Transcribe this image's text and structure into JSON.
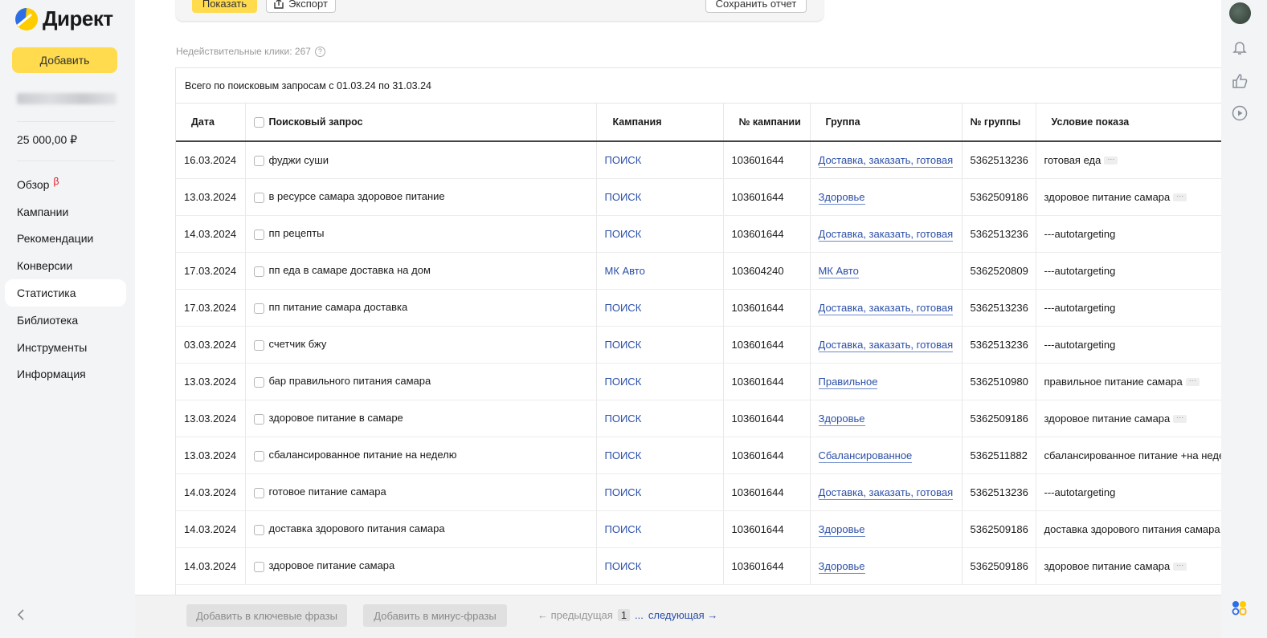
{
  "app": {
    "logo_text": "Директ",
    "brand_colors": {
      "yellow": "#ffdb4d",
      "link": "#2b4fa8",
      "beta": "#e0101e"
    }
  },
  "sidebar": {
    "add_label": "Добавить",
    "balance": "25 000,00 ₽",
    "items": [
      {
        "label": "Обзор",
        "badge": "β",
        "active": false
      },
      {
        "label": "Кампании",
        "active": false
      },
      {
        "label": "Рекомендации",
        "active": false
      },
      {
        "label": "Конверсии",
        "active": false
      },
      {
        "label": "Статистика",
        "active": true
      },
      {
        "label": "Библиотека",
        "active": false
      },
      {
        "label": "Инструменты",
        "active": false
      },
      {
        "label": "Информация",
        "active": false
      }
    ]
  },
  "toolbar": {
    "show_label": "Показать",
    "export_label": "Экспорт",
    "save_label": "Сохранить отчет"
  },
  "invalid_clicks": "Недействительные клики: 267",
  "table": {
    "total_label": "Всего по поисковым запросам с 01.03.24 по 31.03.24",
    "headers": [
      "Дата",
      "Поисковый запрос",
      "Кампания",
      "№ кампании",
      "Группа",
      "№ группы",
      "Условие показа"
    ],
    "rows": [
      {
        "date": "16.03.2024",
        "query": "фуджи суши",
        "campaign": "ПОИСК",
        "campaign_id": "103601644",
        "group": "Доставка, заказать, готовая",
        "group_id": "5362513236",
        "condition": "готовая еда",
        "more": true
      },
      {
        "date": "13.03.2024",
        "query": "в ресурсе самара здоровое питание",
        "campaign": "ПОИСК",
        "campaign_id": "103601644",
        "group": "Здоровье",
        "group_id": "5362509186",
        "condition": "здоровое питание самара",
        "more": true
      },
      {
        "date": "14.03.2024",
        "query": "пп рецепты",
        "campaign": "ПОИСК",
        "campaign_id": "103601644",
        "group": "Доставка, заказать, готовая",
        "group_id": "5362513236",
        "condition": "---autotargeting",
        "more": false
      },
      {
        "date": "17.03.2024",
        "query": "пп еда в самаре доставка на дом",
        "campaign": "МК Авто",
        "campaign_id": "103604240",
        "group": "МК Авто",
        "group_id": "5362520809",
        "condition": "---autotargeting",
        "more": false
      },
      {
        "date": "17.03.2024",
        "query": "пп питание самара доставка",
        "campaign": "ПОИСК",
        "campaign_id": "103601644",
        "group": "Доставка, заказать, готовая",
        "group_id": "5362513236",
        "condition": "---autotargeting",
        "more": false
      },
      {
        "date": "03.03.2024",
        "query": "счетчик бжу",
        "campaign": "ПОИСК",
        "campaign_id": "103601644",
        "group": "Доставка, заказать, готовая",
        "group_id": "5362513236",
        "condition": "---autotargeting",
        "more": false
      },
      {
        "date": "13.03.2024",
        "query": "бар правильного питания самара",
        "campaign": "ПОИСК",
        "campaign_id": "103601644",
        "group": "Правильное",
        "group_id": "5362510980",
        "condition": "правильное питание самара",
        "more": true
      },
      {
        "date": "13.03.2024",
        "query": "здоровое питание в самаре",
        "campaign": "ПОИСК",
        "campaign_id": "103601644",
        "group": "Здоровье",
        "group_id": "5362509186",
        "condition": "здоровое питание самара",
        "more": true
      },
      {
        "date": "13.03.2024",
        "query": "сбалансированное питание на неделю",
        "campaign": "ПОИСК",
        "campaign_id": "103601644",
        "group": "Сбалансированное",
        "group_id": "5362511882",
        "condition": "сбалансированное питание +на неде",
        "more": false
      },
      {
        "date": "14.03.2024",
        "query": "готовое питание самара",
        "campaign": "ПОИСК",
        "campaign_id": "103601644",
        "group": "Доставка, заказать, готовая",
        "group_id": "5362513236",
        "condition": "---autotargeting",
        "more": false
      },
      {
        "date": "14.03.2024",
        "query": "доставка здорового питания самара",
        "campaign": "ПОИСК",
        "campaign_id": "103601644",
        "group": "Здоровье",
        "group_id": "5362509186",
        "condition": "доставка здорового питания самара",
        "more": false
      },
      {
        "date": "14.03.2024",
        "query": "здоровое питание самара",
        "campaign": "ПОИСК",
        "campaign_id": "103601644",
        "group": "Здоровье",
        "group_id": "5362509186",
        "condition": "здоровое питание самара",
        "more": true
      }
    ]
  },
  "bottom_bar": {
    "add_keywords_label": "Добавить в ключевые фразы",
    "add_minus_label": "Добавить в минус-фразы",
    "prev_label": "← предыдущая",
    "current_page": "1",
    "dots": "...",
    "next_label": "следующая →"
  },
  "icons": {
    "help": "question-circle-icon",
    "export": "export-icon",
    "bell": "bell-icon",
    "thumb": "thumbs-up-icon",
    "play": "play-circle-icon",
    "services": "services-grid-icon",
    "collapse": "chevron-left-icon"
  }
}
